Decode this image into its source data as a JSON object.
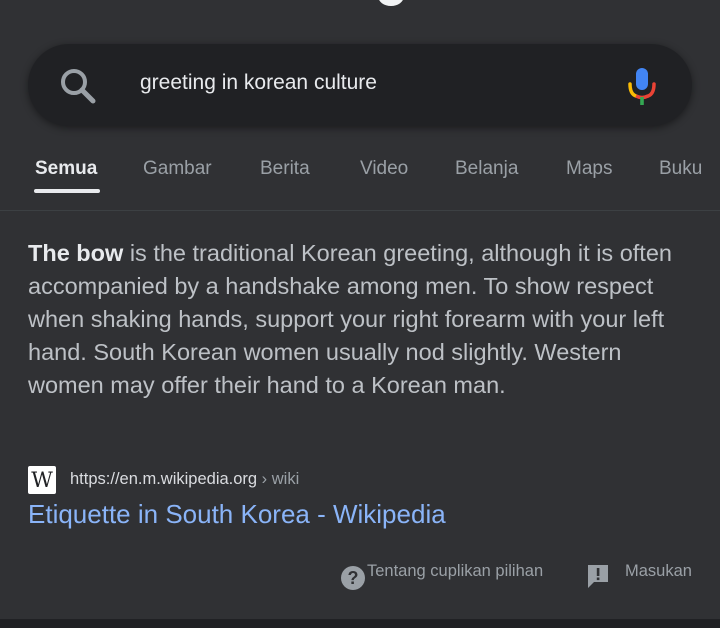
{
  "search": {
    "query": "greeting in korean culture"
  },
  "tabs": [
    {
      "label": "Semua",
      "active": true
    },
    {
      "label": "Gambar",
      "active": false
    },
    {
      "label": "Berita",
      "active": false
    },
    {
      "label": "Video",
      "active": false
    },
    {
      "label": "Belanja",
      "active": false
    },
    {
      "label": "Maps",
      "active": false
    },
    {
      "label": "Buku",
      "active": false
    }
  ],
  "snippet": {
    "bold": "The bow",
    "text": " is the traditional Korean greeting, although it is often accompanied by a handshake among men. To show respect when shaking hands, support your right forearm with your left hand. South Korean women usually nod slightly. Western women may offer their hand to a Korean man."
  },
  "source": {
    "logo_letter": "W",
    "url": "https://en.m.wikipedia.org",
    "breadcrumb": " › wiki",
    "title": "Etiquette in South Korea - Wikipedia"
  },
  "footer": {
    "about_label": "Tentang cuplikan pilihan",
    "feedback_label": "Masukan"
  },
  "colors": {
    "background": "#303134",
    "search_bar": "#202124",
    "link": "#8ab4f8",
    "mic_blue": "#4285f4",
    "mic_red": "#ea4335",
    "mic_yellow": "#fbbc05",
    "mic_green": "#34a853"
  },
  "icons": {
    "search": "search-icon",
    "mic": "mic-icon",
    "about": "help-circle-icon",
    "feedback": "feedback-icon",
    "source_logo": "wikipedia-logo"
  }
}
